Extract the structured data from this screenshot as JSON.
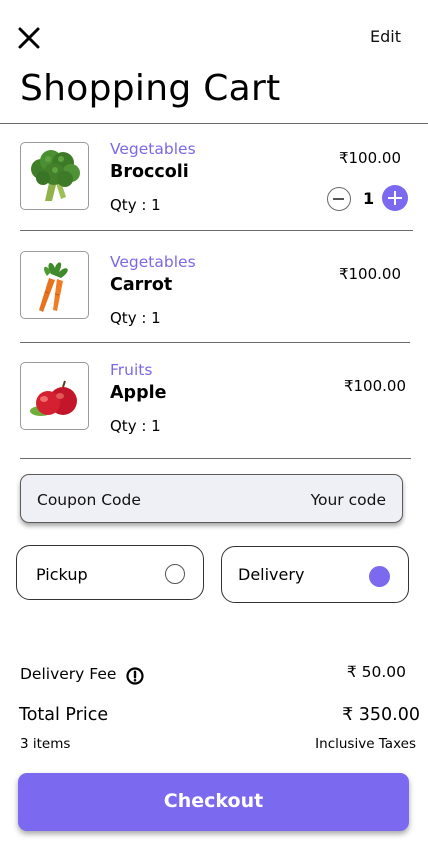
{
  "header": {
    "title": "Shopping Cart",
    "edit_label": "Edit"
  },
  "items": [
    {
      "category": "Vegetables",
      "name": "Broccoli",
      "qty_label": "Qty :  1",
      "price": "₹100.00",
      "stepper_value": "1"
    },
    {
      "category": "Vegetables",
      "name": "Carrot",
      "qty_label": "Qty :  1",
      "price": "₹100.00"
    },
    {
      "category": "Fruits",
      "name": "Apple",
      "qty_label": "Qty :  1",
      "price": "₹100.00"
    }
  ],
  "coupon": {
    "label": "Coupon Code",
    "value": "Your code"
  },
  "fulfillment": {
    "options": [
      {
        "label": "Pickup",
        "selected": false
      },
      {
        "label": "Delivery",
        "selected": true
      }
    ]
  },
  "summary": {
    "delivery_fee_label": "Delivery Fee",
    "delivery_fee_value": "₹ 50.00",
    "total_label": "Total Price",
    "total_value": "₹ 350.00",
    "items_count": "3  items",
    "taxes_note": "Inclusive Taxes"
  },
  "checkout_label": "Checkout",
  "colors": {
    "accent": "#7b69f0",
    "category_text": "#7b69e6",
    "coupon_bg": "#efeff6"
  },
  "icons": [
    "close-icon",
    "info-icon",
    "minus-icon",
    "plus-icon",
    "broccoli-image",
    "carrot-image",
    "apple-image"
  ]
}
